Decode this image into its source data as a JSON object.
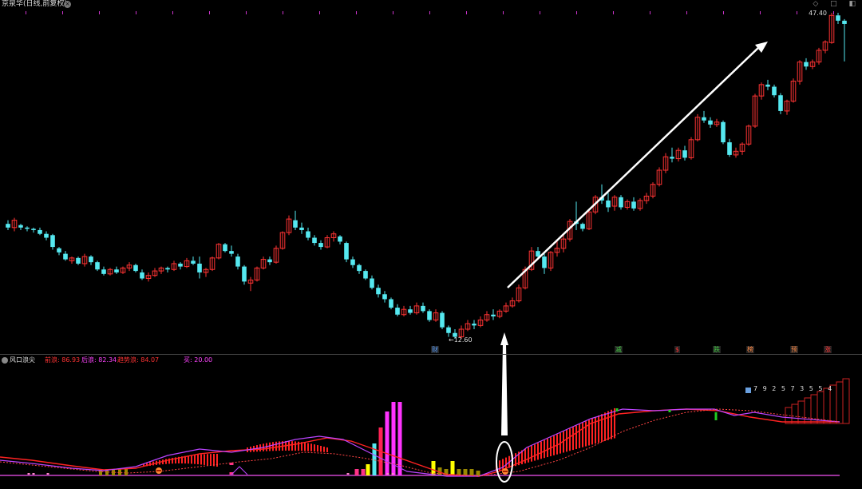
{
  "window": {
    "title": "京泉华(日线,前复权)",
    "close_glyph": "×",
    "icons": "◇ □ ◧"
  },
  "price_panel": {
    "high_label": "47.40",
    "low_label": "←12.60"
  },
  "signals": [
    {
      "label": "财",
      "color": "#5aa0ff"
    },
    {
      "label": "减",
      "color": "#44cc44"
    },
    {
      "label": "$",
      "color": "#ff3333"
    },
    {
      "label": "跌",
      "color": "#44cc44"
    },
    {
      "label": "榜",
      "color": "#ff8844"
    },
    {
      "label": "预",
      "color": "#ff8844"
    },
    {
      "label": "涨",
      "color": "#ff3333"
    }
  ],
  "indicator": {
    "name": "风口浪尖",
    "field1": "前浪: 86.93",
    "field2": "后浪: 82.34",
    "field3": "趋势浪: 84.07",
    "field4": "买: 20.00",
    "sequence": "7 9 2 5 7 3 5 5 4"
  },
  "colors": {
    "up": "#ff3333",
    "down": "#55e8f0",
    "magenta": "#ff33ff",
    "yellow": "#ffff00",
    "olive": "#998800",
    "purple": "#bb44ff",
    "baseline": "#cc44cc"
  },
  "chart_data": {
    "type": "candlestick",
    "series": [
      {
        "name": "price",
        "candles": [
          [
            20.1,
            20.4,
            19.6,
            19.8
          ],
          [
            19.8,
            20.6,
            19.5,
            20.4
          ],
          [
            20.0,
            20.1,
            19.6,
            19.8
          ],
          [
            19.8,
            19.9,
            19.5,
            19.7
          ],
          [
            19.7,
            19.8,
            19.4,
            19.6
          ],
          [
            19.6,
            19.8,
            19.2,
            19.3
          ],
          [
            19.3,
            19.5,
            18.8,
            19.0
          ],
          [
            19.2,
            19.3,
            18.1,
            18.3
          ],
          [
            18.2,
            18.3,
            17.7,
            17.9
          ],
          [
            17.8,
            18.0,
            17.3,
            17.4
          ],
          [
            17.3,
            17.6,
            17.1,
            17.5
          ],
          [
            17.5,
            17.6,
            17.0,
            17.1
          ],
          [
            17.1,
            17.8,
            16.9,
            17.6
          ],
          [
            17.6,
            17.7,
            17.0,
            17.2
          ],
          [
            17.2,
            17.3,
            16.6,
            16.7
          ],
          [
            16.7,
            16.9,
            16.3,
            16.4
          ],
          [
            16.4,
            16.8,
            16.3,
            16.7
          ],
          [
            16.7,
            16.9,
            16.4,
            16.5
          ],
          [
            16.5,
            16.9,
            16.4,
            16.8
          ],
          [
            16.8,
            17.2,
            16.6,
            17.0
          ],
          [
            17.0,
            17.1,
            16.5,
            16.6
          ],
          [
            16.5,
            16.7,
            16.0,
            16.1
          ],
          [
            16.1,
            16.5,
            15.9,
            16.3
          ],
          [
            16.3,
            16.8,
            16.2,
            16.6
          ],
          [
            16.6,
            16.9,
            16.4,
            16.8
          ],
          [
            16.8,
            16.9,
            16.5,
            16.7
          ],
          [
            16.7,
            17.3,
            16.6,
            17.1
          ],
          [
            17.1,
            17.2,
            16.7,
            16.9
          ],
          [
            16.9,
            17.5,
            16.8,
            17.3
          ],
          [
            17.3,
            17.6,
            17.0,
            17.1
          ],
          [
            17.1,
            17.6,
            16.1,
            16.5
          ],
          [
            16.5,
            16.8,
            16.2,
            16.7
          ],
          [
            16.7,
            17.6,
            16.6,
            17.5
          ],
          [
            17.5,
            18.6,
            17.4,
            18.5
          ],
          [
            18.5,
            18.6,
            17.9,
            18.0
          ],
          [
            18.0,
            18.4,
            17.6,
            17.8
          ],
          [
            17.6,
            17.8,
            16.7,
            16.9
          ],
          [
            16.9,
            17.0,
            15.7,
            15.9
          ],
          [
            15.8,
            16.2,
            15.3,
            16.0
          ],
          [
            16.0,
            16.9,
            15.9,
            16.8
          ],
          [
            16.8,
            17.6,
            16.7,
            17.4
          ],
          [
            17.4,
            17.6,
            17.0,
            17.2
          ],
          [
            17.2,
            18.4,
            17.1,
            18.2
          ],
          [
            18.2,
            19.5,
            18.1,
            19.4
          ],
          [
            19.4,
            20.8,
            19.2,
            20.5
          ],
          [
            20.4,
            21.2,
            19.6,
            19.8
          ],
          [
            19.8,
            20.2,
            19.3,
            19.6
          ],
          [
            19.5,
            19.8,
            18.8,
            19.0
          ],
          [
            19.0,
            19.2,
            18.4,
            18.6
          ],
          [
            18.6,
            18.8,
            18.1,
            18.3
          ],
          [
            18.3,
            19.2,
            18.2,
            19.0
          ],
          [
            19.0,
            19.5,
            18.7,
            19.3
          ],
          [
            19.1,
            19.2,
            18.5,
            18.7
          ],
          [
            18.6,
            18.7,
            17.2,
            17.4
          ],
          [
            17.4,
            17.6,
            16.8,
            17.0
          ],
          [
            17.0,
            17.1,
            16.4,
            16.6
          ],
          [
            16.6,
            16.7,
            16.0,
            16.1
          ],
          [
            16.1,
            16.3,
            15.4,
            15.5
          ],
          [
            15.5,
            15.7,
            14.9,
            15.1
          ],
          [
            15.1,
            15.3,
            14.6,
            14.8
          ],
          [
            14.8,
            14.9,
            14.2,
            14.3
          ],
          [
            14.3,
            14.5,
            13.8,
            13.9
          ],
          [
            13.9,
            14.4,
            13.8,
            14.2
          ],
          [
            14.2,
            14.4,
            13.9,
            14.0
          ],
          [
            14.0,
            14.6,
            13.9,
            14.4
          ],
          [
            14.4,
            14.6,
            14.0,
            14.1
          ],
          [
            14.1,
            14.2,
            13.5,
            13.6
          ],
          [
            13.6,
            14.2,
            13.5,
            14.0
          ],
          [
            14.0,
            14.1,
            13.1,
            13.2
          ],
          [
            13.2,
            13.3,
            12.7,
            12.9
          ],
          [
            12.9,
            13.1,
            12.6,
            12.7
          ],
          [
            12.7,
            13.3,
            12.6,
            13.1
          ],
          [
            13.1,
            13.6,
            13.0,
            13.4
          ],
          [
            13.4,
            13.6,
            13.1,
            13.3
          ],
          [
            13.3,
            13.8,
            13.2,
            13.6
          ],
          [
            13.6,
            14.1,
            13.5,
            13.9
          ],
          [
            13.9,
            14.2,
            13.6,
            13.8
          ],
          [
            13.8,
            14.2,
            13.7,
            14.1
          ],
          [
            14.1,
            14.6,
            14.0,
            14.4
          ],
          [
            14.4,
            14.9,
            14.3,
            14.7
          ],
          [
            14.7,
            15.7,
            14.6,
            15.5
          ],
          [
            15.5,
            16.9,
            15.4,
            16.7
          ],
          [
            16.7,
            18.3,
            16.6,
            18.0
          ],
          [
            18.0,
            18.3,
            17.4,
            17.6
          ],
          [
            17.6,
            17.9,
            16.4,
            16.8
          ],
          [
            16.8,
            18.0,
            16.6,
            17.9
          ],
          [
            17.9,
            18.8,
            17.6,
            18.2
          ],
          [
            18.2,
            19.2,
            17.9,
            18.9
          ],
          [
            18.9,
            20.5,
            18.7,
            20.3
          ],
          [
            20.3,
            22.0,
            19.6,
            20.1
          ],
          [
            20.1,
            20.2,
            19.5,
            19.7
          ],
          [
            19.7,
            21.3,
            19.6,
            21.1
          ],
          [
            21.1,
            22.6,
            20.9,
            22.4
          ],
          [
            22.4,
            23.6,
            21.8,
            22.1
          ],
          [
            22.1,
            22.8,
            21.1,
            21.5
          ],
          [
            21.6,
            22.6,
            21.2,
            22.4
          ],
          [
            22.4,
            22.6,
            21.3,
            21.5
          ],
          [
            21.5,
            22.2,
            21.3,
            22.0
          ],
          [
            22.0,
            22.4,
            21.2,
            21.4
          ],
          [
            21.4,
            22.3,
            21.2,
            22.1
          ],
          [
            22.1,
            22.8,
            21.8,
            22.5
          ],
          [
            22.5,
            23.8,
            22.3,
            23.6
          ],
          [
            23.6,
            25.3,
            23.4,
            25.0
          ],
          [
            25.0,
            26.8,
            24.7,
            26.4
          ],
          [
            26.4,
            27.4,
            25.8,
            26.2
          ],
          [
            26.2,
            27.4,
            25.9,
            27.1
          ],
          [
            27.1,
            27.6,
            26.0,
            26.3
          ],
          [
            26.3,
            28.6,
            26.1,
            28.3
          ],
          [
            28.3,
            31.4,
            28.1,
            31.0
          ],
          [
            31.0,
            31.8,
            30.3,
            30.6
          ],
          [
            30.6,
            31.0,
            29.7,
            30.1
          ],
          [
            30.1,
            30.8,
            29.8,
            30.4
          ],
          [
            30.4,
            30.6,
            27.8,
            28.0
          ],
          [
            28.0,
            28.4,
            26.4,
            26.6
          ],
          [
            26.6,
            27.4,
            26.3,
            27.0
          ],
          [
            27.0,
            28.0,
            26.6,
            27.8
          ],
          [
            27.8,
            30.1,
            27.6,
            29.9
          ],
          [
            29.9,
            34.1,
            29.7,
            33.8
          ],
          [
            33.8,
            35.7,
            33.3,
            35.4
          ],
          [
            35.4,
            36.1,
            34.6,
            35.1
          ],
          [
            35.1,
            35.4,
            33.6,
            33.9
          ],
          [
            33.9,
            34.2,
            31.4,
            31.8
          ],
          [
            31.8,
            33.3,
            31.3,
            33.1
          ],
          [
            33.1,
            36.3,
            32.9,
            35.9
          ],
          [
            35.9,
            39.1,
            35.4,
            38.8
          ],
          [
            38.8,
            39.4,
            37.6,
            38.1
          ],
          [
            38.1,
            39.2,
            37.7,
            38.8
          ],
          [
            38.8,
            41.1,
            38.4,
            40.7
          ],
          [
            40.7,
            42.4,
            40.2,
            42.1
          ],
          [
            42.0,
            47.4,
            41.8,
            46.9
          ],
          [
            46.9,
            47.4,
            45.3,
            45.9
          ],
          [
            45.9,
            46.2,
            38.9,
            45.3
          ]
        ]
      }
    ]
  }
}
